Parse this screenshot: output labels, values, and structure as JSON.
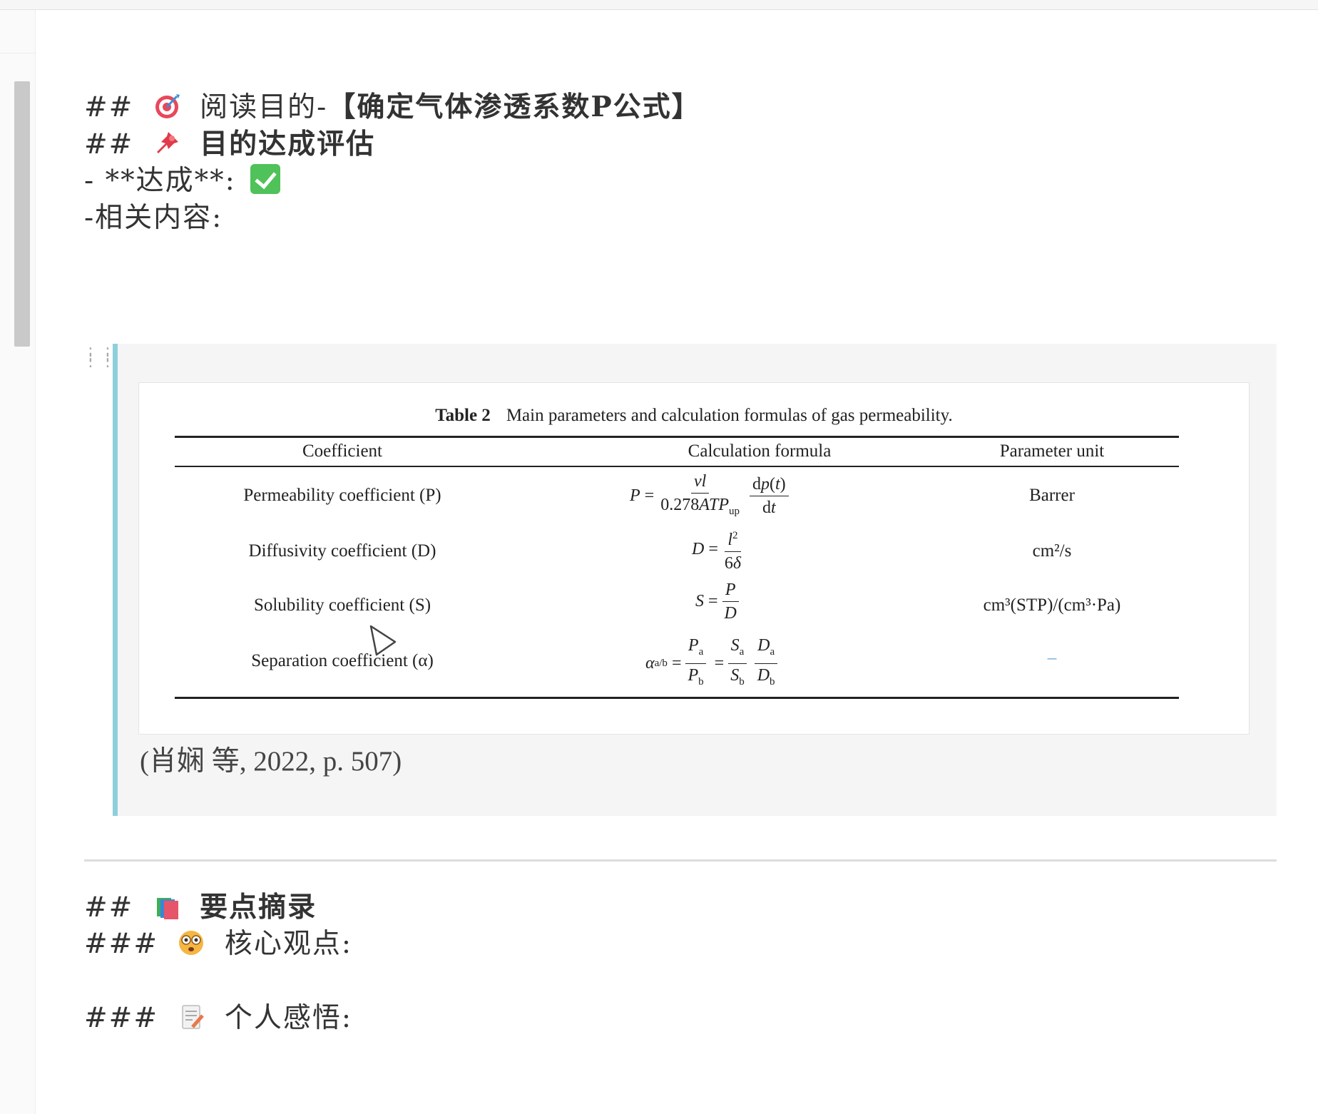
{
  "note": {
    "line1": {
      "prefix": "##",
      "emoji": "dart-icon",
      "text": "阅读目的-",
      "bold": "【确定气体渗透系数P公式】"
    },
    "line2": {
      "prefix": "##",
      "emoji": "pushpin-icon",
      "bold": "目的达成评估"
    },
    "line3": {
      "text": "- **达成**:",
      "emoji": "check-mark-icon"
    },
    "line4": {
      "text": "-相关内容:"
    },
    "line5": {
      "prefix": "##",
      "emoji": "books-icon",
      "bold": "要点摘录"
    },
    "line6": {
      "prefix": "###",
      "emoji": "face-icon",
      "text": "核心观点:"
    },
    "line7": {
      "prefix": "###",
      "emoji": "memo-icon",
      "text": "个人感悟:"
    }
  },
  "table": {
    "label": "Table 2",
    "caption": "Main parameters and calculation formulas of gas permeability.",
    "headers": [
      "Coefficient",
      "Calculation formula",
      "Parameter unit"
    ],
    "rows": [
      {
        "coefficient": "Permeability coefficient (P)",
        "unit": "Barrer"
      },
      {
        "coefficient": "Diffusivity coefficient (D)",
        "unit": "cm²/s"
      },
      {
        "coefficient": "Solubility coefficient (S)",
        "unit": "cm³(STP)/(cm³·Pa)"
      },
      {
        "coefficient": "Separation coefficient (α)",
        "unit": "–"
      }
    ]
  },
  "citation": "(肖娴 等, 2022, p. 507)",
  "colors": {
    "quote_border": "#8ecfdc",
    "quote_bg": "#f5f5f5",
    "check_green": "#4fc25a"
  }
}
